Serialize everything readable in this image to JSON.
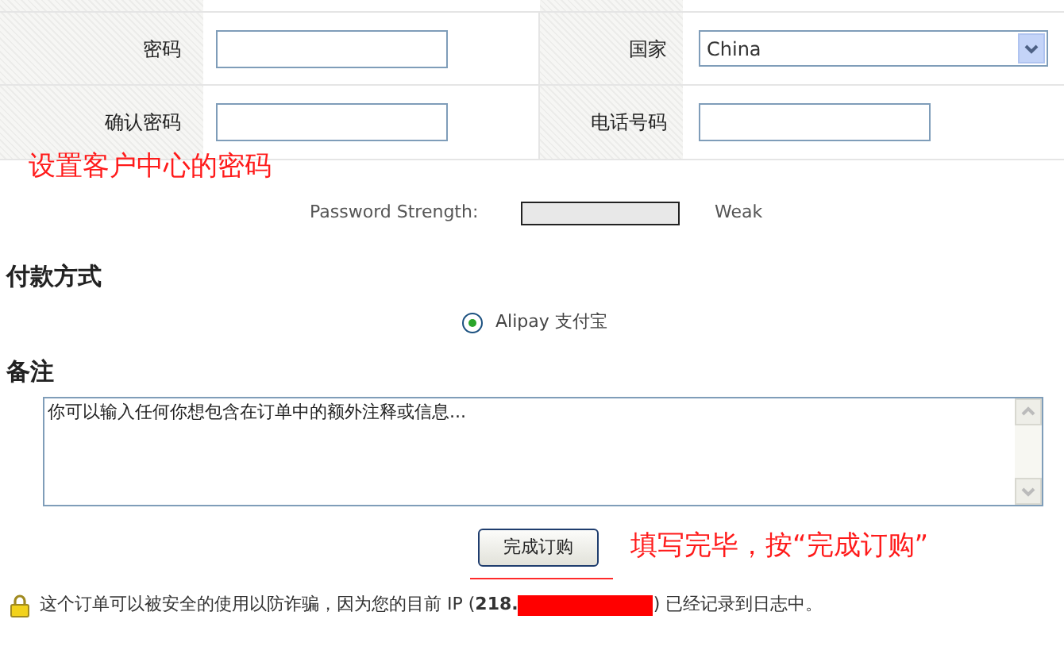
{
  "form_rows": [
    {
      "left_label": "密码",
      "right_label": "国家",
      "kind": "select",
      "right_value": "China"
    },
    {
      "left_label": "确认密码",
      "right_label": "电话号码",
      "kind": "input"
    }
  ],
  "annotation_password": "设置客户中心的密码",
  "password_strength": {
    "label": "Password Strength:",
    "reading": "Weak"
  },
  "payment": {
    "heading": "付款方式",
    "options": [
      {
        "label": "Alipay 支付宝",
        "selected": true
      }
    ]
  },
  "notes": {
    "heading": "备注",
    "value": "你可以输入任何你想包含在订单中的额外注释或信息..."
  },
  "submit_button": "完成订购",
  "annotation_submit": "填写完毕，按“完成订购”",
  "footer": {
    "before": "这个订单可以被安全的使用以防诈骗，因为您的目前 IP (**218.**",
    "after": ") 已经记录到日志中。"
  }
}
